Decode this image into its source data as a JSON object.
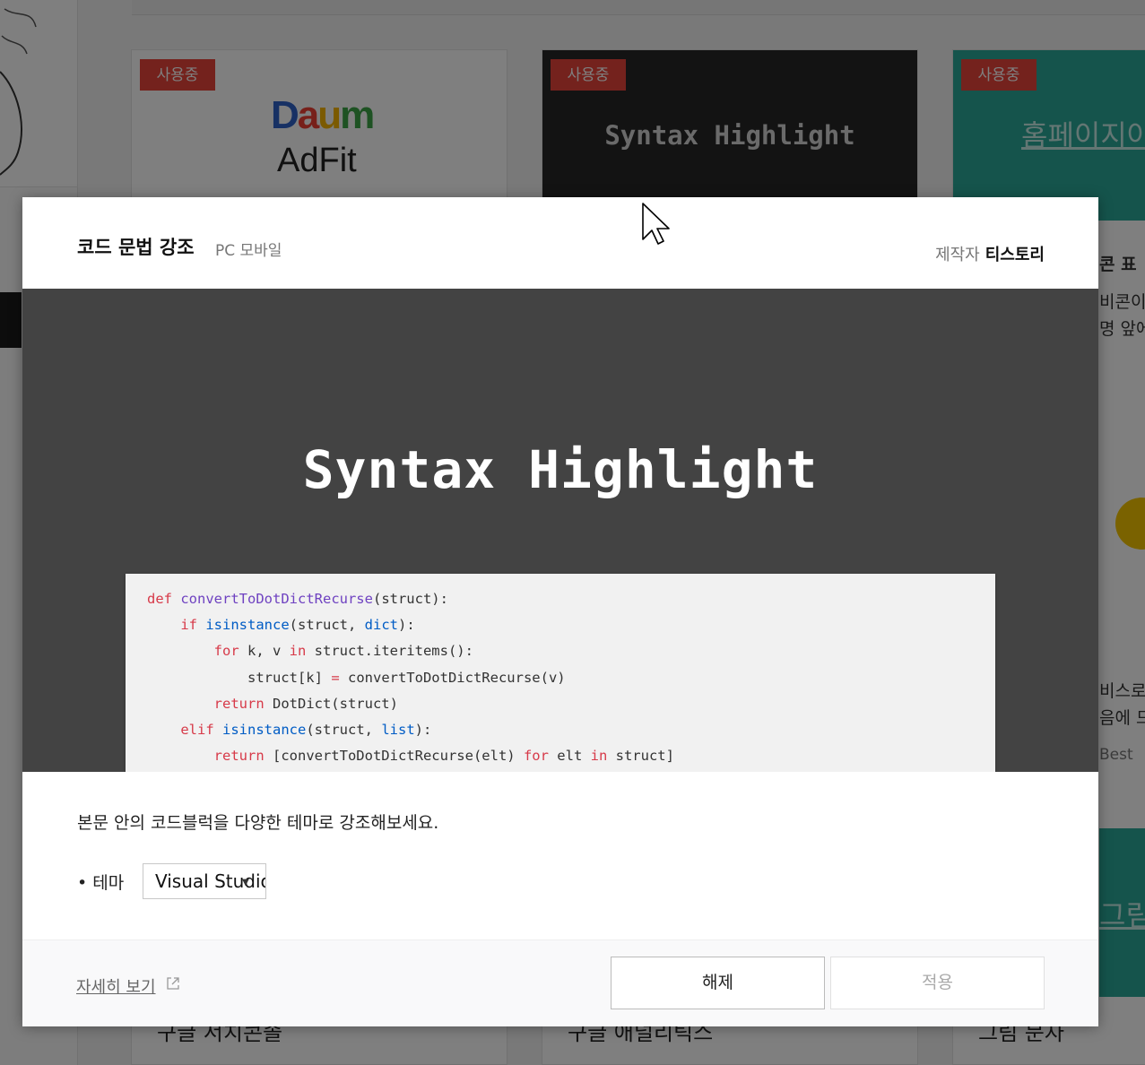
{
  "background": {
    "cards": [
      {
        "badge": "사용중",
        "name": "구글 서치콘솔",
        "logo_daum": "Daum",
        "logo_adfit": "AdFit"
      },
      {
        "badge": "사용중",
        "name": "구글 애널리틱스",
        "thumb_title": "Syntax Highlight"
      },
      {
        "badge": "사용중",
        "name": "그림 문자",
        "thumb_text": "홈페이지아"
      }
    ],
    "side_texts": [
      "콘 표",
      "비콘이",
      "명 앞에",
      "비스로",
      "음에 드",
      "Best",
      "그림"
    ]
  },
  "modal": {
    "title": "코드 문법 강조",
    "platforms": "PC 모바일",
    "author_label": "제작자",
    "author_name": "티스토리",
    "preview": {
      "title": "Syntax Highlight",
      "code_lines": [
        "def convertToDotDictRecurse(struct):",
        "    if isinstance(struct, dict):",
        "        for k, v in struct.iteritems():",
        "            struct[k] = convertToDotDictRecurse(v)",
        "        return DotDict(struct)",
        "    elif isinstance(struct, list):",
        "        return [convertToDotDictRecurse(elt) for elt in struct]"
      ]
    },
    "description": "본문 안의 코드블럭을 다양한 테마로 강조해보세요.",
    "theme": {
      "label": "• 테마",
      "selected": "Visual Studio"
    },
    "footer": {
      "detail_link": "자세히 보기",
      "release_button": "해제",
      "apply_button": "적용"
    }
  },
  "colors": {
    "badge": "#e9443a",
    "preview_bg": "#434343",
    "code_keyword": "#d73a49",
    "code_function": "#6f42c1",
    "code_builtin": "#005cc5"
  }
}
